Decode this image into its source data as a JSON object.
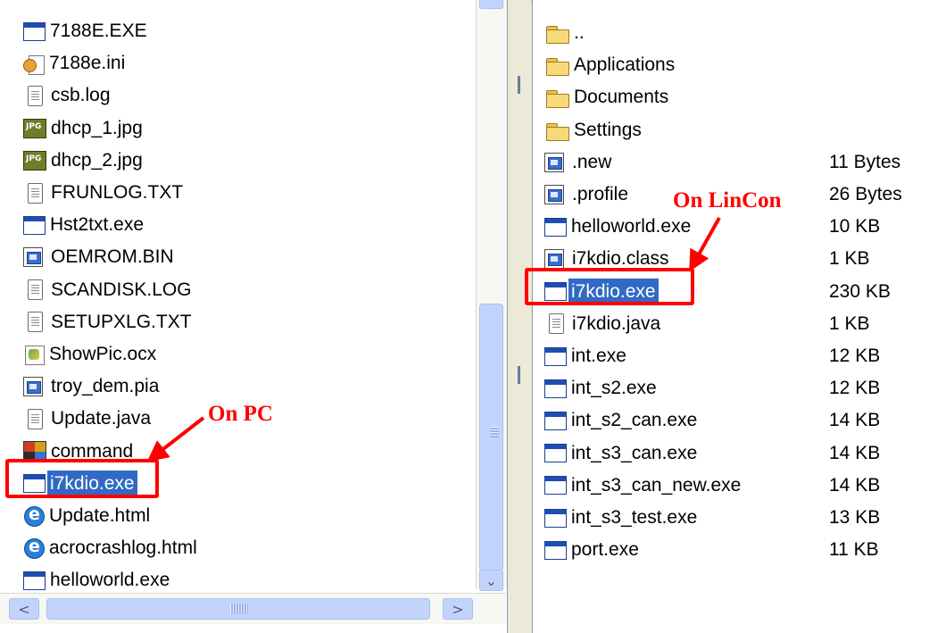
{
  "left_panel": {
    "files": [
      {
        "name": "7188E.EXE",
        "icon": "exe-icon"
      },
      {
        "name": "7188e.ini",
        "icon": "ini-icon"
      },
      {
        "name": "csb.log",
        "icon": "text-file-icon"
      },
      {
        "name": "dhcp_1.jpg",
        "icon": "jpg-icon"
      },
      {
        "name": "dhcp_2.jpg",
        "icon": "jpg-icon"
      },
      {
        "name": "FRUNLOG.TXT",
        "icon": "text-file-icon"
      },
      {
        "name": "Hst2txt.exe",
        "icon": "exe-icon"
      },
      {
        "name": "OEMROM.BIN",
        "icon": "bin-icon"
      },
      {
        "name": "SCANDISK.LOG",
        "icon": "text-file-icon"
      },
      {
        "name": "SETUPXLG.TXT",
        "icon": "text-file-icon"
      },
      {
        "name": "ShowPic.ocx",
        "icon": "ocx-icon"
      },
      {
        "name": "troy_dem.pia",
        "icon": "pia-icon"
      },
      {
        "name": "Update.java",
        "icon": "text-file-icon"
      },
      {
        "name": "command",
        "icon": "command-icon"
      },
      {
        "name": "i7kdio.exe",
        "icon": "exe-icon",
        "selected": true
      },
      {
        "name": "Update.html",
        "icon": "html-icon"
      },
      {
        "name": "acrocrashlog.html",
        "icon": "html-icon"
      },
      {
        "name": "helloworld.exe",
        "icon": "exe-icon"
      }
    ],
    "annotation": "On PC"
  },
  "right_panel": {
    "files": [
      {
        "name": "..",
        "size": "",
        "icon": "folder-icon"
      },
      {
        "name": "Applications",
        "size": "",
        "icon": "folder-icon"
      },
      {
        "name": "Documents",
        "size": "",
        "icon": "folder-icon"
      },
      {
        "name": "Settings",
        "size": "",
        "icon": "folder-icon"
      },
      {
        "name": ".new",
        "size": "11 Bytes",
        "icon": "bin-icon"
      },
      {
        "name": ".profile",
        "size": "26 Bytes",
        "icon": "bin-icon"
      },
      {
        "name": "helloworld.exe",
        "size": "10 KB",
        "icon": "exe-icon"
      },
      {
        "name": "i7kdio.class",
        "size": "1 KB",
        "icon": "bin-icon"
      },
      {
        "name": "i7kdio.exe",
        "size": "230 KB",
        "icon": "exe-icon",
        "selected": true
      },
      {
        "name": "i7kdio.java",
        "size": "1 KB",
        "icon": "text-file-icon"
      },
      {
        "name": "int.exe",
        "size": "12 KB",
        "icon": "exe-icon"
      },
      {
        "name": "int_s2.exe",
        "size": "12 KB",
        "icon": "exe-icon"
      },
      {
        "name": "int_s2_can.exe",
        "size": "14 KB",
        "icon": "exe-icon"
      },
      {
        "name": "int_s3_can.exe",
        "size": "14 KB",
        "icon": "exe-icon"
      },
      {
        "name": "int_s3_can_new.exe",
        "size": "14 KB",
        "icon": "exe-icon"
      },
      {
        "name": "int_s3_test.exe",
        "size": "13 KB",
        "icon": "exe-icon"
      },
      {
        "name": "port.exe",
        "size": "11 KB",
        "icon": "exe-icon"
      }
    ],
    "annotation": "On LinCon"
  },
  "scrollbars": {
    "up_arrow": "▲",
    "down_arrow": "⌄",
    "left_arrow": "<",
    "right_arrow": ">"
  },
  "colors": {
    "annotation": "#ff0000",
    "selection": "#316ac5",
    "scrollbar_thumb": "#c3d4fc"
  }
}
